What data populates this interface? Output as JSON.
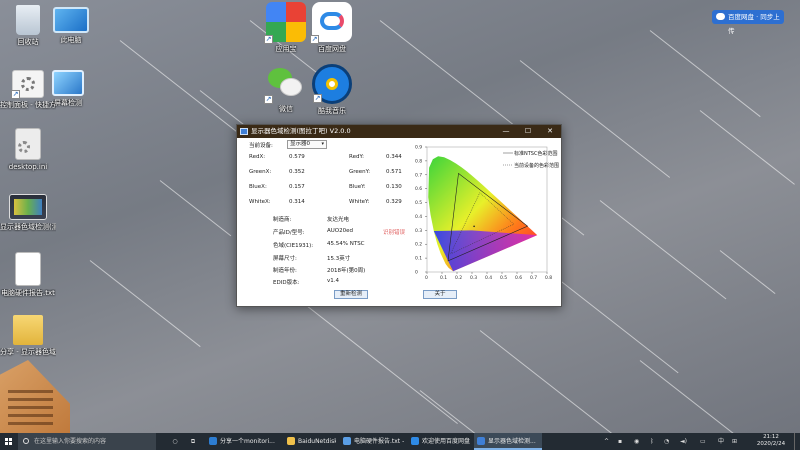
{
  "desktop": {
    "icons": [
      {
        "label": "回收站",
        "icon": "recycle-bin-icon"
      },
      {
        "label": "此电脑",
        "icon": "computer-icon"
      },
      {
        "label": "控制面板 - 快捷方式",
        "icon": "gears-icon"
      },
      {
        "label": "屏幕检测",
        "icon": "monitor-test-icon"
      },
      {
        "label": "desktop.ini",
        "icon": "ini-file-icon"
      },
      {
        "label": "显示器色域检测(测绘)...jpg",
        "icon": "image-file-icon"
      },
      {
        "label": "电脑硬件报告.txt",
        "icon": "text-file-icon"
      },
      {
        "label": "分享 - 显示器色域检测",
        "icon": "folder-icon"
      },
      {
        "label": "应用宝",
        "icon": "app-store-icon"
      },
      {
        "label": "百度网盘",
        "icon": "baidu-netdisk-icon"
      },
      {
        "label": "微信",
        "icon": "wechat-icon"
      },
      {
        "label": "酷我音乐",
        "icon": "music-player-icon"
      }
    ],
    "cloud_button": "百度网盘 · 同步上传"
  },
  "window": {
    "title": "显示器色域检测(图拉丁吧) V2.0.0",
    "device_label": "当前设备:",
    "device_value": "显示器0",
    "coords": {
      "redx_label": "RedX:",
      "redx": "0.579",
      "redy_label": "RedY:",
      "redy": "0.344",
      "greenx_label": "GreenX:",
      "greenx": "0.352",
      "greeny_label": "GreenY:",
      "greeny": "0.571",
      "bluex_label": "BlueX:",
      "bluex": "0.157",
      "bluey_label": "BlueY:",
      "bluey": "0.130",
      "whitex_label": "WhiteX:",
      "whitex": "0.314",
      "whitey_label": "WhiteY:",
      "whitey": "0.329"
    },
    "info": {
      "maker_label": "制造商:",
      "maker": "友达光电",
      "product_label": "产品ID/型号:",
      "product": "AUO20ed",
      "product_link": "识别错误",
      "gamut_label": "色域(CIE1931):",
      "gamut": "45.54% NTSC",
      "size_label": "屏幕尺寸:",
      "size": "15.3英寸",
      "date_label": "制造年份:",
      "date": "2018年(第0周)",
      "edid_label": "EDID版本:",
      "edid": "v1.4"
    },
    "redetect_button": "重新检测",
    "close_button": "关于",
    "legend_ntsc": "标准NTSC色彩范围",
    "legend_device": "当前设备的色彩范围"
  },
  "chart_data": {
    "type": "scatter",
    "title": "",
    "xlabel": "",
    "ylabel": "",
    "xlim": [
      0,
      0.8
    ],
    "ylim": [
      0,
      0.9
    ],
    "x_ticks": [
      "0",
      "0.1",
      "0.2",
      "0.3",
      "0.4",
      "0.5",
      "0.6",
      "0.7",
      "0.8"
    ],
    "y_ticks": [
      "0",
      "0.1",
      "0.2",
      "0.3",
      "0.4",
      "0.5",
      "0.6",
      "0.7",
      "0.8",
      "0.9"
    ],
    "ntsc_triangle": [
      [
        0.67,
        0.33
      ],
      [
        0.21,
        0.71
      ],
      [
        0.14,
        0.08
      ]
    ],
    "device_triangle": [
      [
        0.579,
        0.344
      ],
      [
        0.352,
        0.571
      ],
      [
        0.157,
        0.13
      ]
    ],
    "white_point": [
      0.314,
      0.329
    ]
  },
  "taskbar": {
    "search_placeholder": "在这里输入你要搜索的内容",
    "tasks": [
      {
        "label": "分享一个monitori...",
        "color": "#2d7dd2",
        "active": false
      },
      {
        "label": "BaiduNetdiskDo...",
        "color": "#f0c14b",
        "active": false
      },
      {
        "label": "电脑硬件报告.txt -...",
        "color": "#5a9ee6",
        "active": false
      },
      {
        "label": "欢迎使用百度网盘",
        "color": "#2e8ae6",
        "active": false
      },
      {
        "label": "显示器色域检测...",
        "color": "#3f7fd6",
        "active": true
      }
    ],
    "time": "21:12",
    "date": "2020/2/24"
  }
}
